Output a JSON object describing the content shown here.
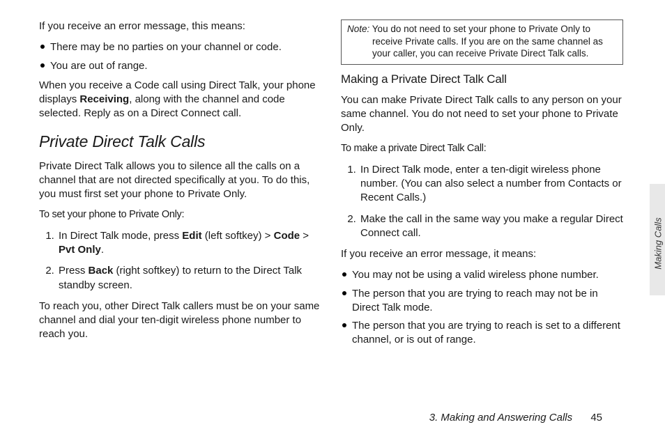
{
  "left": {
    "intro": "If you receive an error message, this means:",
    "bullets1": [
      "There may be no parties on your channel or code.",
      "You are out of range."
    ],
    "para2_a": "When you receive a Code call using Direct Talk, your phone displays ",
    "para2_bold": "Receiving",
    "para2_b": ", along with the channel and code selected. Reply as on a Direct Connect call.",
    "h2": "Private Direct Talk Calls",
    "para3": "Private Direct Talk allows you to silence all the calls on a channel that are not directed specifically at you. To do this, you must first set your phone to Private Only.",
    "leadin1": "To set your phone to Private Only:",
    "steps1": {
      "s1_a": "In Direct Talk mode, press ",
      "s1_b1": "Edit",
      "s1_c": " (left softkey) ",
      "s1_gt1": ">",
      "s1_b2": " Code ",
      "s1_gt2": ">",
      "s1_b3": " Pvt Only",
      "s1_end": ".",
      "s2_a": "Press ",
      "s2_b": "Back",
      "s2_c": " (right softkey) to return to the Direct Talk standby screen."
    },
    "para4": "To reach you, other Direct Talk callers must be on your same channel and dial your ten-digit wireless phone number to reach you."
  },
  "right": {
    "note_label": "Note:",
    "note_body": "You do not need to set your phone to Private Only to receive Private calls. If you are on the same channel as your caller, you can receive Private Direct Talk calls.",
    "h3": "Making a Private Direct Talk Call",
    "para1": "You can make Private Direct Talk calls to any person on your same channel. You do not need to set your phone to Private Only.",
    "leadin1": "To make a private Direct Talk Call:",
    "steps1": [
      "In Direct Talk mode, enter a ten-digit wireless phone number. (You can also select a number from Contacts or Recent Calls.)",
      "Make the call in the same way you make a regular Direct Connect call."
    ],
    "para2": "If you receive an error message, it means:",
    "bullets1": [
      "You may not be using a valid wireless phone number.",
      "The person that you are trying to reach may not be in Direct Talk mode.",
      "The person that you are trying to reach is set to a different channel, or is out of range."
    ]
  },
  "side_tab": "Making Calls",
  "footer": {
    "section": "3. Making and Answering Calls",
    "page": "45"
  }
}
